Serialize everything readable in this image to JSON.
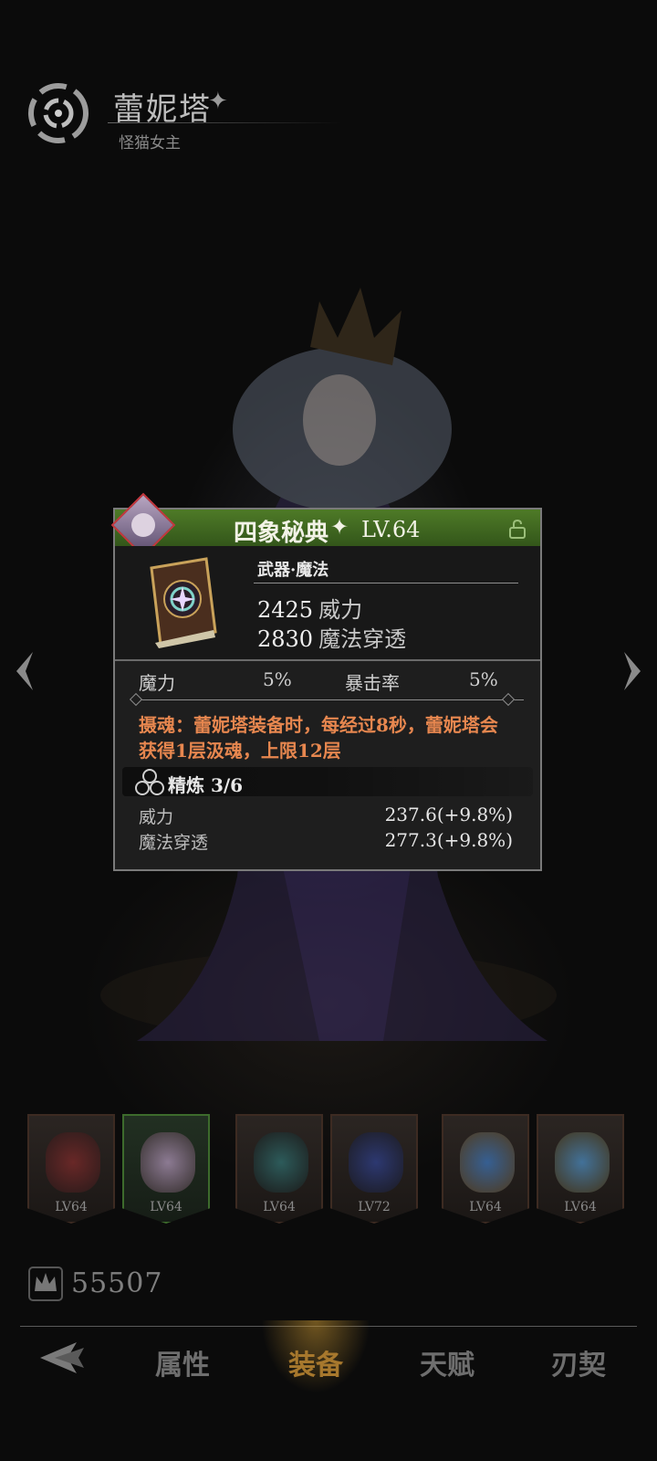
{
  "hero": {
    "name": "蕾妮塔",
    "title": "怪猫女主"
  },
  "item": {
    "name": "四象秘典",
    "level": "LV.64",
    "type": "武器·魔法",
    "main_stats": [
      {
        "value": "2425",
        "label": "威力"
      },
      {
        "value": "2830",
        "label": "魔法穿透"
      }
    ],
    "sub_stats": [
      {
        "label": "魔力",
        "value": "5%"
      },
      {
        "label": "暴击率",
        "value": "5%"
      }
    ],
    "effect": "摄魂：蕾妮塔装备时，每经过8秒，蕾妮塔会获得1层汲魂，上限12层",
    "refine": {
      "label": "精炼 3/6",
      "rows": [
        {
          "label": "威力",
          "value": "237.6(+9.8%)"
        },
        {
          "label": "魔法穿透",
          "value": "277.3(+9.8%)"
        }
      ]
    }
  },
  "equipment_slots": [
    {
      "level": "LV64"
    },
    {
      "level": "LV64"
    },
    {
      "level": "LV64"
    },
    {
      "level": "LV72"
    },
    {
      "level": "LV64"
    },
    {
      "level": "LV64"
    }
  ],
  "power": "55507",
  "tabs": [
    "属性",
    "装备",
    "天赋",
    "刃契"
  ],
  "selected_tab": "装备",
  "colors": {
    "header_green": "#4e7a27",
    "effect_orange": "#e7874f",
    "tab_selected": "#a7782d"
  }
}
